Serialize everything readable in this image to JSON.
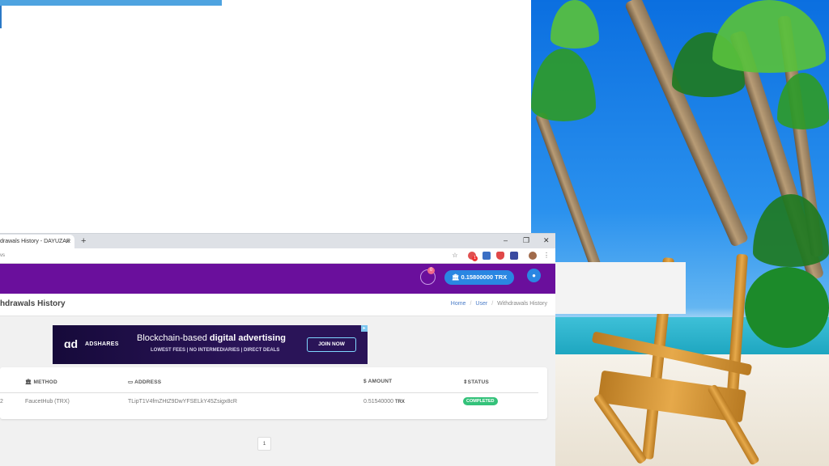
{
  "browser": {
    "tab_title": "drawals History - DAYUZAR",
    "tab_close": "×",
    "new_tab": "+",
    "url": "vs",
    "window_controls": {
      "minimize": "–",
      "restore": "❐",
      "close": "✕"
    },
    "extension_badge": "1",
    "menu": "⋮"
  },
  "navbar": {
    "notification_count": "0",
    "balance": "0.15800000 TRX",
    "bank_icon": "bank-icon",
    "user_icon": "user-icon"
  },
  "page": {
    "title": "hdrawals History",
    "breadcrumb": {
      "home": "Home",
      "user": "User",
      "current": "Withdrawals History",
      "sep": "/"
    }
  },
  "ad": {
    "brand": "ADSHARES",
    "headline_pre": "Blockchain-based ",
    "headline_bold": "digital advertising",
    "subline": "LOWEST FEES | NO INTERMEDIARIES | DIRECT DEALS",
    "cta": "JOIN NOW"
  },
  "table": {
    "headers": {
      "method": "METHOD",
      "address": "ADDRESS",
      "amount": "AMOUNT",
      "status": "STATUS"
    },
    "rows": [
      {
        "id": "2",
        "method": "FaucetHub (TRX)",
        "address": "TLipT1V4fmZHtZ9DwYFSELkY45Zsigx8cR",
        "amount": "0.51540000",
        "unit": "TRX",
        "status": "COMPLETED"
      }
    ]
  },
  "pagination": {
    "current": "1"
  },
  "colors": {
    "nav": "#6a0f9c",
    "primary": "#2a86e2",
    "success": "#34c27a"
  }
}
